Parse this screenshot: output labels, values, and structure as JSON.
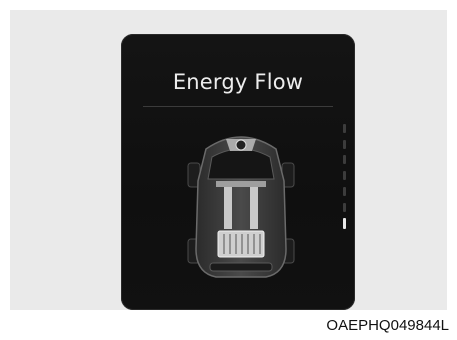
{
  "screen": {
    "title": "Energy Flow"
  },
  "image_code": "OAEPHQ049844L",
  "battery_level": {
    "segments_total": 7,
    "segments_lit": 1
  },
  "icons": [
    "vehicle-energy-flow-icon"
  ]
}
